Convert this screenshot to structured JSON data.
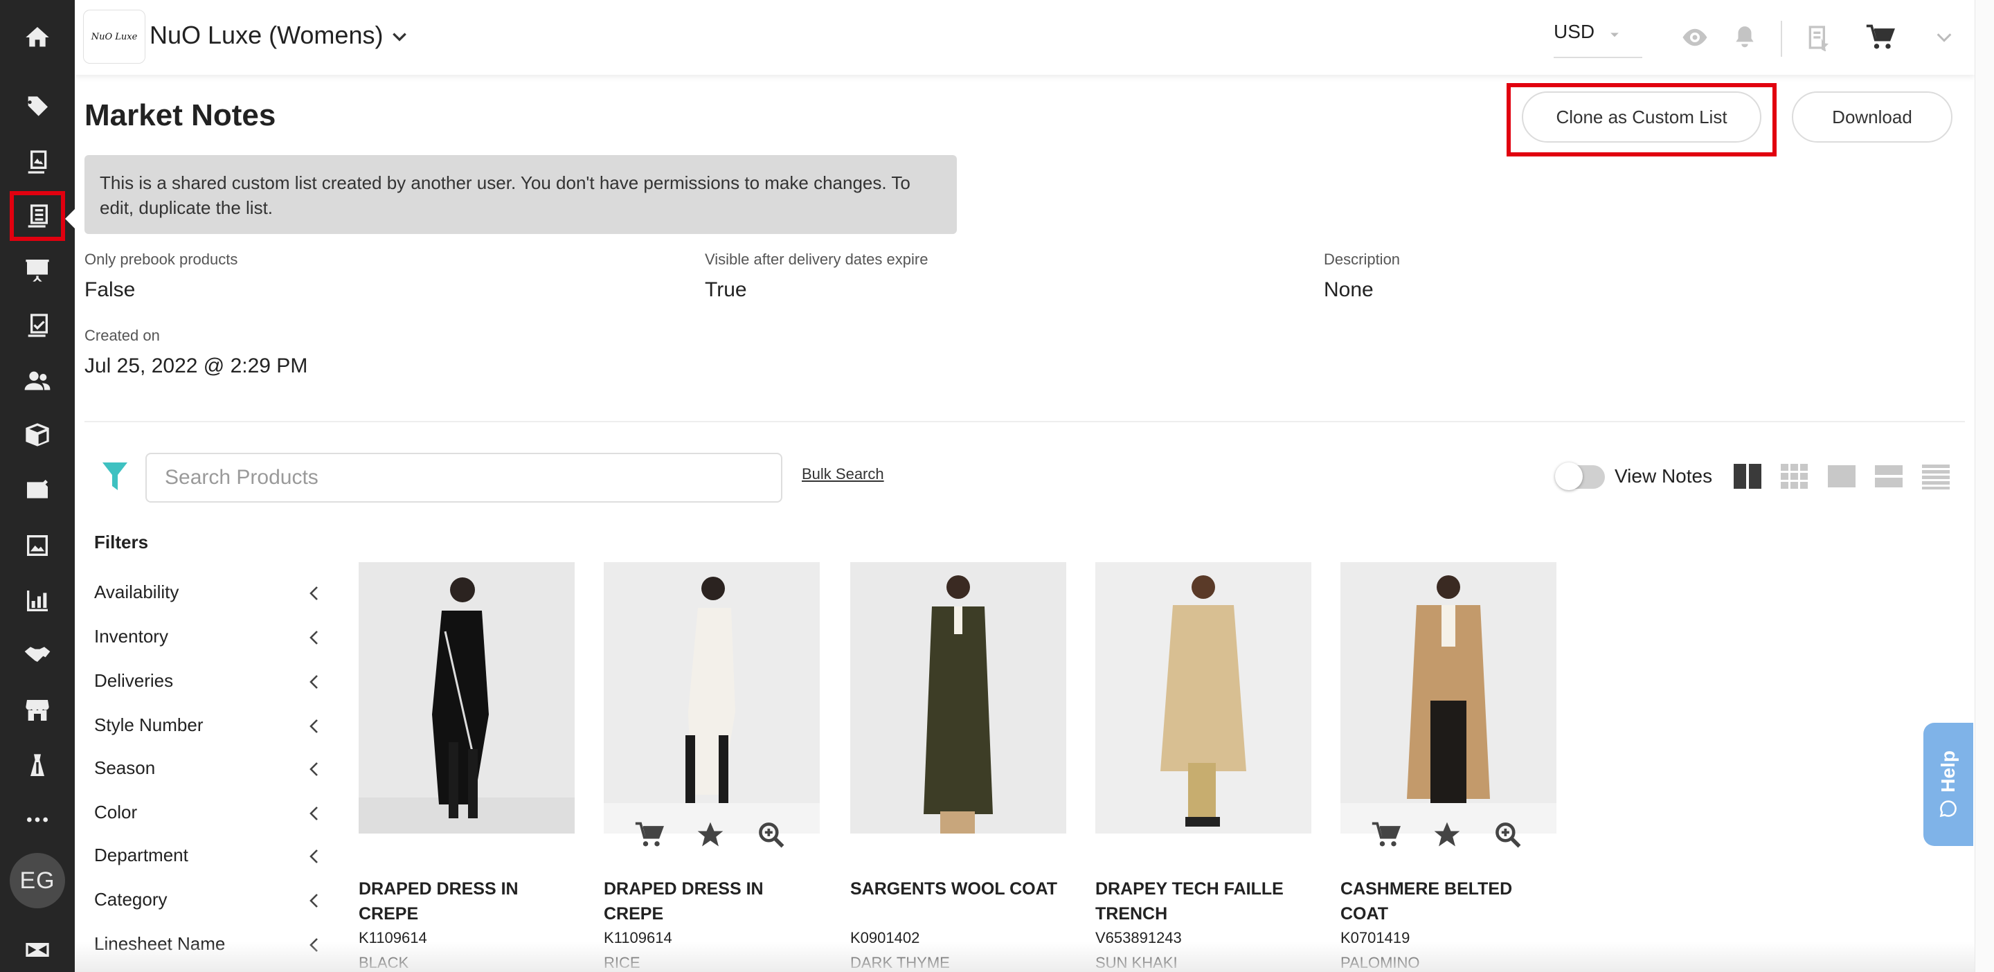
{
  "rail": {
    "items": [
      {
        "name": "home-icon"
      },
      {
        "name": "tag-icon"
      },
      {
        "name": "catalog-icon"
      },
      {
        "name": "linesheets-icon"
      },
      {
        "name": "presentation-icon"
      },
      {
        "name": "orders-checklist-icon"
      },
      {
        "name": "customers-icon"
      },
      {
        "name": "inventory-box-icon"
      },
      {
        "name": "campaign-icon"
      },
      {
        "name": "media-icon"
      },
      {
        "name": "analytics-chart-icon"
      },
      {
        "name": "partners-handshake-icon"
      },
      {
        "name": "storefront-icon"
      },
      {
        "name": "styles-dress-icon"
      },
      {
        "name": "more-icon"
      }
    ],
    "avatar": "EG"
  },
  "header": {
    "brand_logo": "NuO Luxe",
    "brand_name": "NuO Luxe (Womens)",
    "currency": "USD"
  },
  "page": {
    "title": "Market Notes",
    "clone_button": "Clone as Custom List",
    "download_button": "Download",
    "notice": "This is a shared custom list created by another user. You don't have permissions to make changes. To edit, duplicate the list.",
    "meta": {
      "prebook_label": "Only prebook products",
      "prebook_value": "False",
      "visible_label": "Visible after delivery dates expire",
      "visible_value": "True",
      "description_label": "Description",
      "description_value": "None",
      "created_label": "Created on",
      "created_value": "Jul 25, 2022 @ 2:29 PM"
    }
  },
  "toolbar": {
    "search_placeholder": "Search Products",
    "bulk_search": "Bulk Search",
    "view_notes": "View Notes"
  },
  "filters": {
    "title": "Filters",
    "items": [
      "Availability",
      "Inventory",
      "Deliveries",
      "Style Number",
      "Season",
      "Color",
      "Department",
      "Category",
      "Linesheet Name"
    ]
  },
  "products": [
    {
      "name": "DRAPED DRESS IN CREPE",
      "sku": "K1109614",
      "color": "BLACK"
    },
    {
      "name": "DRAPED DRESS IN CREPE",
      "sku": "K1109614",
      "color": "RICE"
    },
    {
      "name": "SARGENTS WOOL COAT",
      "sku": "K0901402",
      "color": "DARK THYME"
    },
    {
      "name": "DRAPEY TECH FAILLE TRENCH",
      "sku": "V653891243",
      "color": "SUN KHAKI"
    },
    {
      "name": "CASHMERE BELTED COAT",
      "sku": "K0701419",
      "color": "PALOMINO"
    }
  ],
  "help": {
    "label": "Help"
  },
  "colors": {
    "rail": "#262626",
    "accent": "#3ec1c1",
    "highlight": "#e1000f",
    "help": "#7fb3e8"
  }
}
